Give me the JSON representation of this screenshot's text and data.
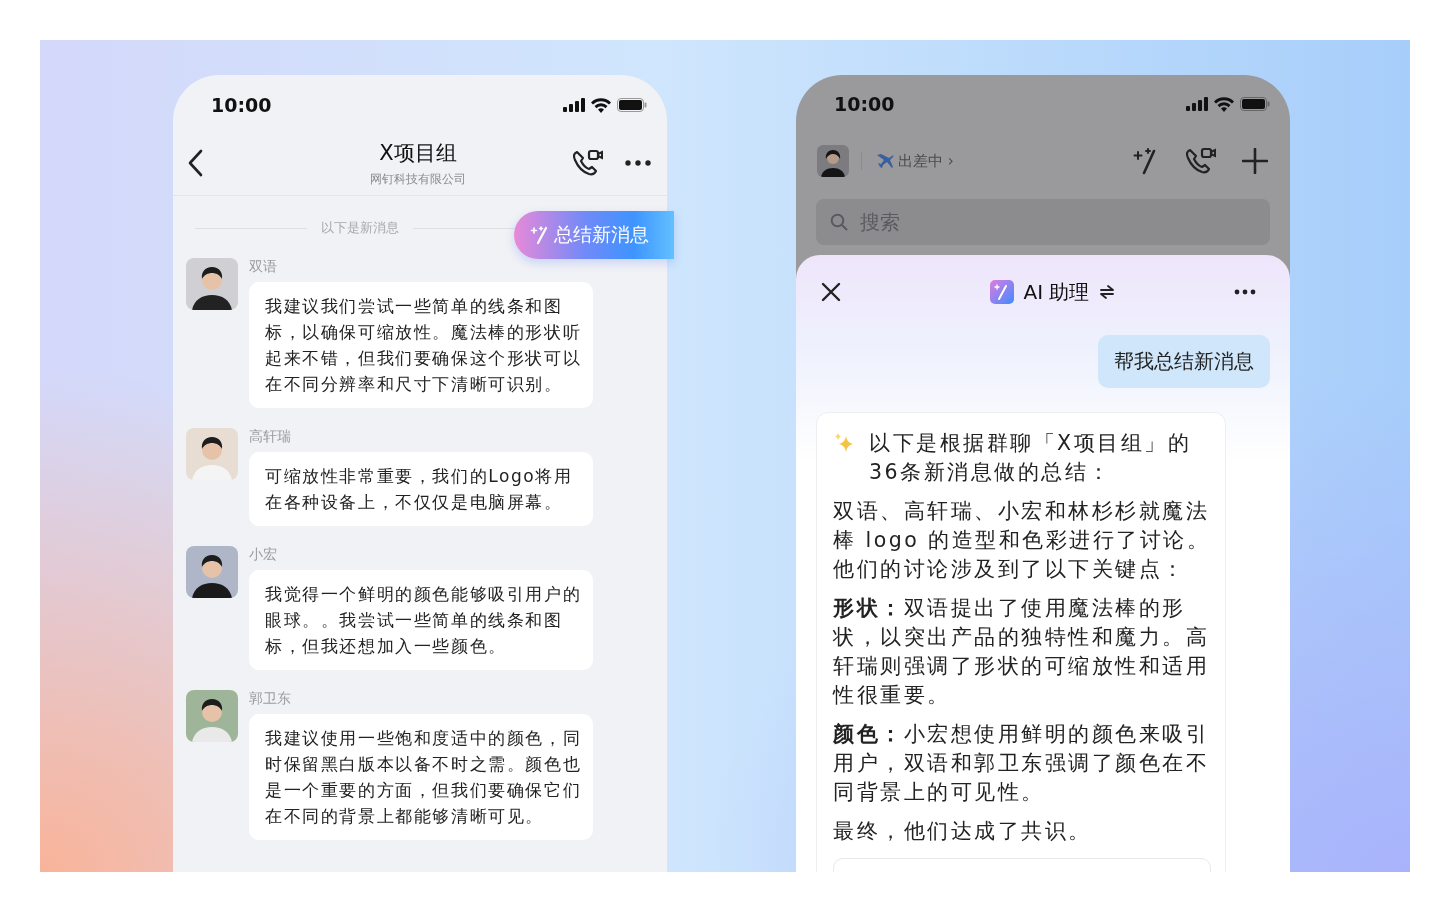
{
  "left_phone": {
    "status_bar": {
      "time": "10:00"
    },
    "header": {
      "title": "X项目组",
      "subtitle": "网钉科技有限公司"
    },
    "new_messages_divider": "以下是新消息",
    "summarize_button": "总结新消息",
    "messages": [
      {
        "sender": "双语",
        "text": "我建议我们尝试一些简单的线条和图标，以确保可缩放性。魔法棒的形状听起来不错，但我们要确保这个形状可以在不同分辨率和尺寸下清晰可识别。"
      },
      {
        "sender": "高轩瑞",
        "text": "可缩放性非常重要，我们的Logo将用在各种设备上，不仅仅是电脑屏幕。"
      },
      {
        "sender": "小宏",
        "text": "我觉得一个鲜明的颜色能够吸引用户的眼球。。我尝试一些简单的线条和图标，但我还想加入一些颜色。"
      },
      {
        "sender": "郭卫东",
        "text": "我建议使用一些饱和度适中的颜色，同时保留黑白版本以备不时之需。颜色也是一个重要的方面，但我们要确保它们在不同的背景上都能够清晰可见。"
      }
    ]
  },
  "right_phone": {
    "status_bar": {
      "time": "10:00"
    },
    "status": "出差中 ›",
    "search": {
      "placeholder": "搜索"
    },
    "assistant": {
      "title": "AI 助理",
      "user_message": "帮我总结新消息",
      "summary": {
        "intro": "以下是根据群聊「X项目组」的36条新消息做的总结：",
        "paragraphs": [
          "双语、高轩瑞、小宏和林杉杉就魔法棒 logo 的造型和色彩进行了讨论。他们的讨论涉及到了以下关键点：",
          "**形状：**双语提出了使用魔法棒的形状，以突出产品的独特性和魔力。高轩瑞则强调了形状的可缩放性和适用性很重要。",
          "**颜色：**小宏想使用鲜明的颜色来吸引用户，双语和郭卫东强调了颜色在不同背景上的可见性。",
          "最终，他们达成了共识。"
        ]
      }
    }
  }
}
